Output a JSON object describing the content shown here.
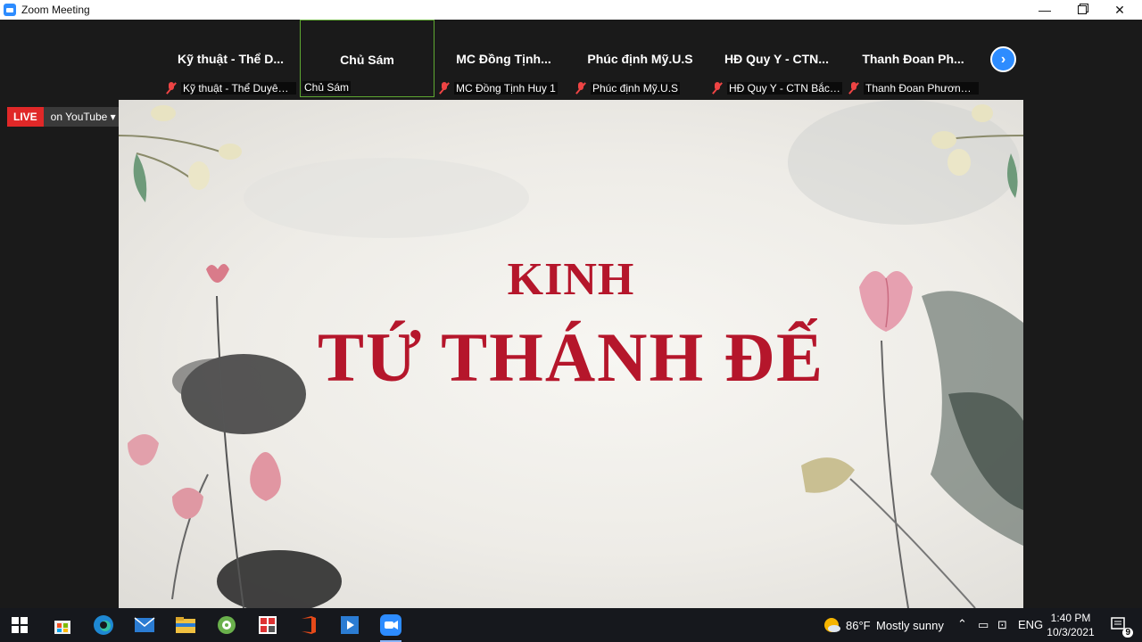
{
  "window": {
    "title": "Zoom Meeting"
  },
  "participants": [
    {
      "tile_name": "Kỹ thuật - Thể D...",
      "label": "Kỹ thuật - Thể Duyên ...",
      "muted": true,
      "active": false
    },
    {
      "tile_name": "Chủ Sám",
      "label": "Chủ Sám",
      "muted": false,
      "active": true
    },
    {
      "tile_name": "MC Đồng Tịnh...",
      "label": "MC Đồng Tịnh Huy 1",
      "muted": true,
      "active": false
    },
    {
      "tile_name": "Phúc định Mỹ.U.S",
      "label": "Phúc định Mỹ.U.S",
      "muted": true,
      "active": false
    },
    {
      "tile_name": "HĐ Quy Y - CTN...",
      "label": "HĐ Quy Y - CTN Bắc ...",
      "muted": true,
      "active": false
    },
    {
      "tile_name": "Thanh Đoan Ph...",
      "label": "Thanh Đoan Phương ...",
      "muted": true,
      "active": false
    }
  ],
  "live": {
    "badge": "LIVE",
    "destination": "on YouTube ▾"
  },
  "slide": {
    "line1": "KINH",
    "line2": "TỨ THÁNH ĐẾ"
  },
  "taskbar": {
    "weather_temp": "86°F",
    "weather_text": "Mostly sunny",
    "language": "ENG",
    "time": "1:40 PM",
    "date": "10/3/2021",
    "notifications": "9"
  },
  "colors": {
    "zoom_blue": "#2d8cff",
    "live_red": "#e02828",
    "title_red": "#b5162b",
    "active_border": "#5fa832"
  }
}
